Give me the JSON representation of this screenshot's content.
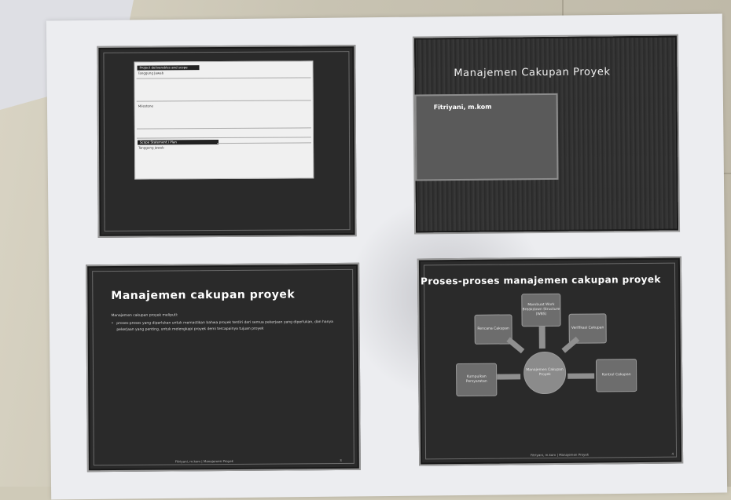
{
  "slide1": {
    "header1": "Project deliverables and scope",
    "sub1": "Tanggung Jawab",
    "mid": "Milestone",
    "header2": "Scope Statement / Plan",
    "sub2": "Tanggung Jawab"
  },
  "slide2": {
    "title": "Manajemen Cakupan Proyek",
    "author": "Fitriyani, m.kom"
  },
  "slide3": {
    "title": "Manajemen cakupan proyek",
    "intro": "Manajemen cakupan proyek meliputi:",
    "bullet": "proses-proses yang diperlukan untuk memastikan bahwa proyek terdiri dari semua pekerjaan yang diperlukan, dan hanya pekerjaan yang penting, untuk melengkapi proyek demi tercapainya tujuan proyek",
    "footer": "Fitriyani, m.kom | Manajemen Proyek",
    "page": "3"
  },
  "slide4": {
    "title": "Proses-proses manajemen cakupan proyek",
    "nodes": {
      "wbs": "Membuat Work Breakdown Structure (WBS)",
      "define": "Rencana Cakupan",
      "verify": "Verifikasi Cakupan",
      "collect": "Kumpulkan Persyaratan",
      "control": "Kontrol Cakupan",
      "center": "Manajemen Cakupan Proyek"
    },
    "footer": "Fitriyani, m.kom | Manajemen Proyek",
    "page": "4"
  }
}
